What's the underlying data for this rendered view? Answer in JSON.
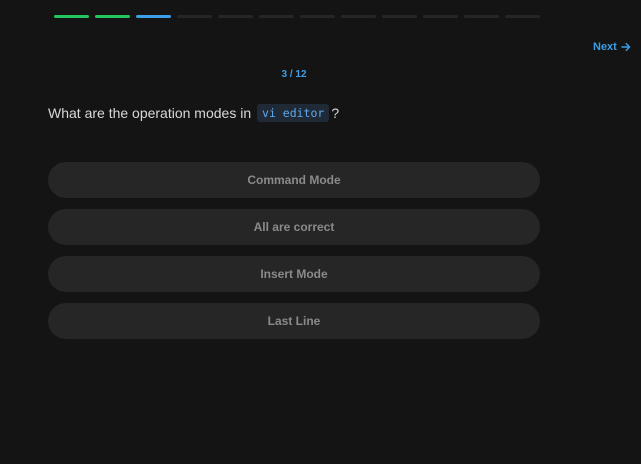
{
  "progress": {
    "total": 12,
    "current": 3,
    "completed": 2,
    "colors": {
      "done": "#22c55e",
      "current": "#3b9ee6",
      "pending": "#262626"
    }
  },
  "nav": {
    "next_label": "Next",
    "next_icon": "arrow-right-icon"
  },
  "counter": "3 / 12",
  "question": {
    "text_before": "What are the operation modes in",
    "code": "vi editor",
    "text_after": "?"
  },
  "options": [
    {
      "label": "Command Mode"
    },
    {
      "label": "All are correct"
    },
    {
      "label": "Insert Mode"
    },
    {
      "label": "Last Line"
    }
  ],
  "colors": {
    "accent": "#3b9ee6",
    "background": "#141414",
    "option_bg": "#262626"
  }
}
